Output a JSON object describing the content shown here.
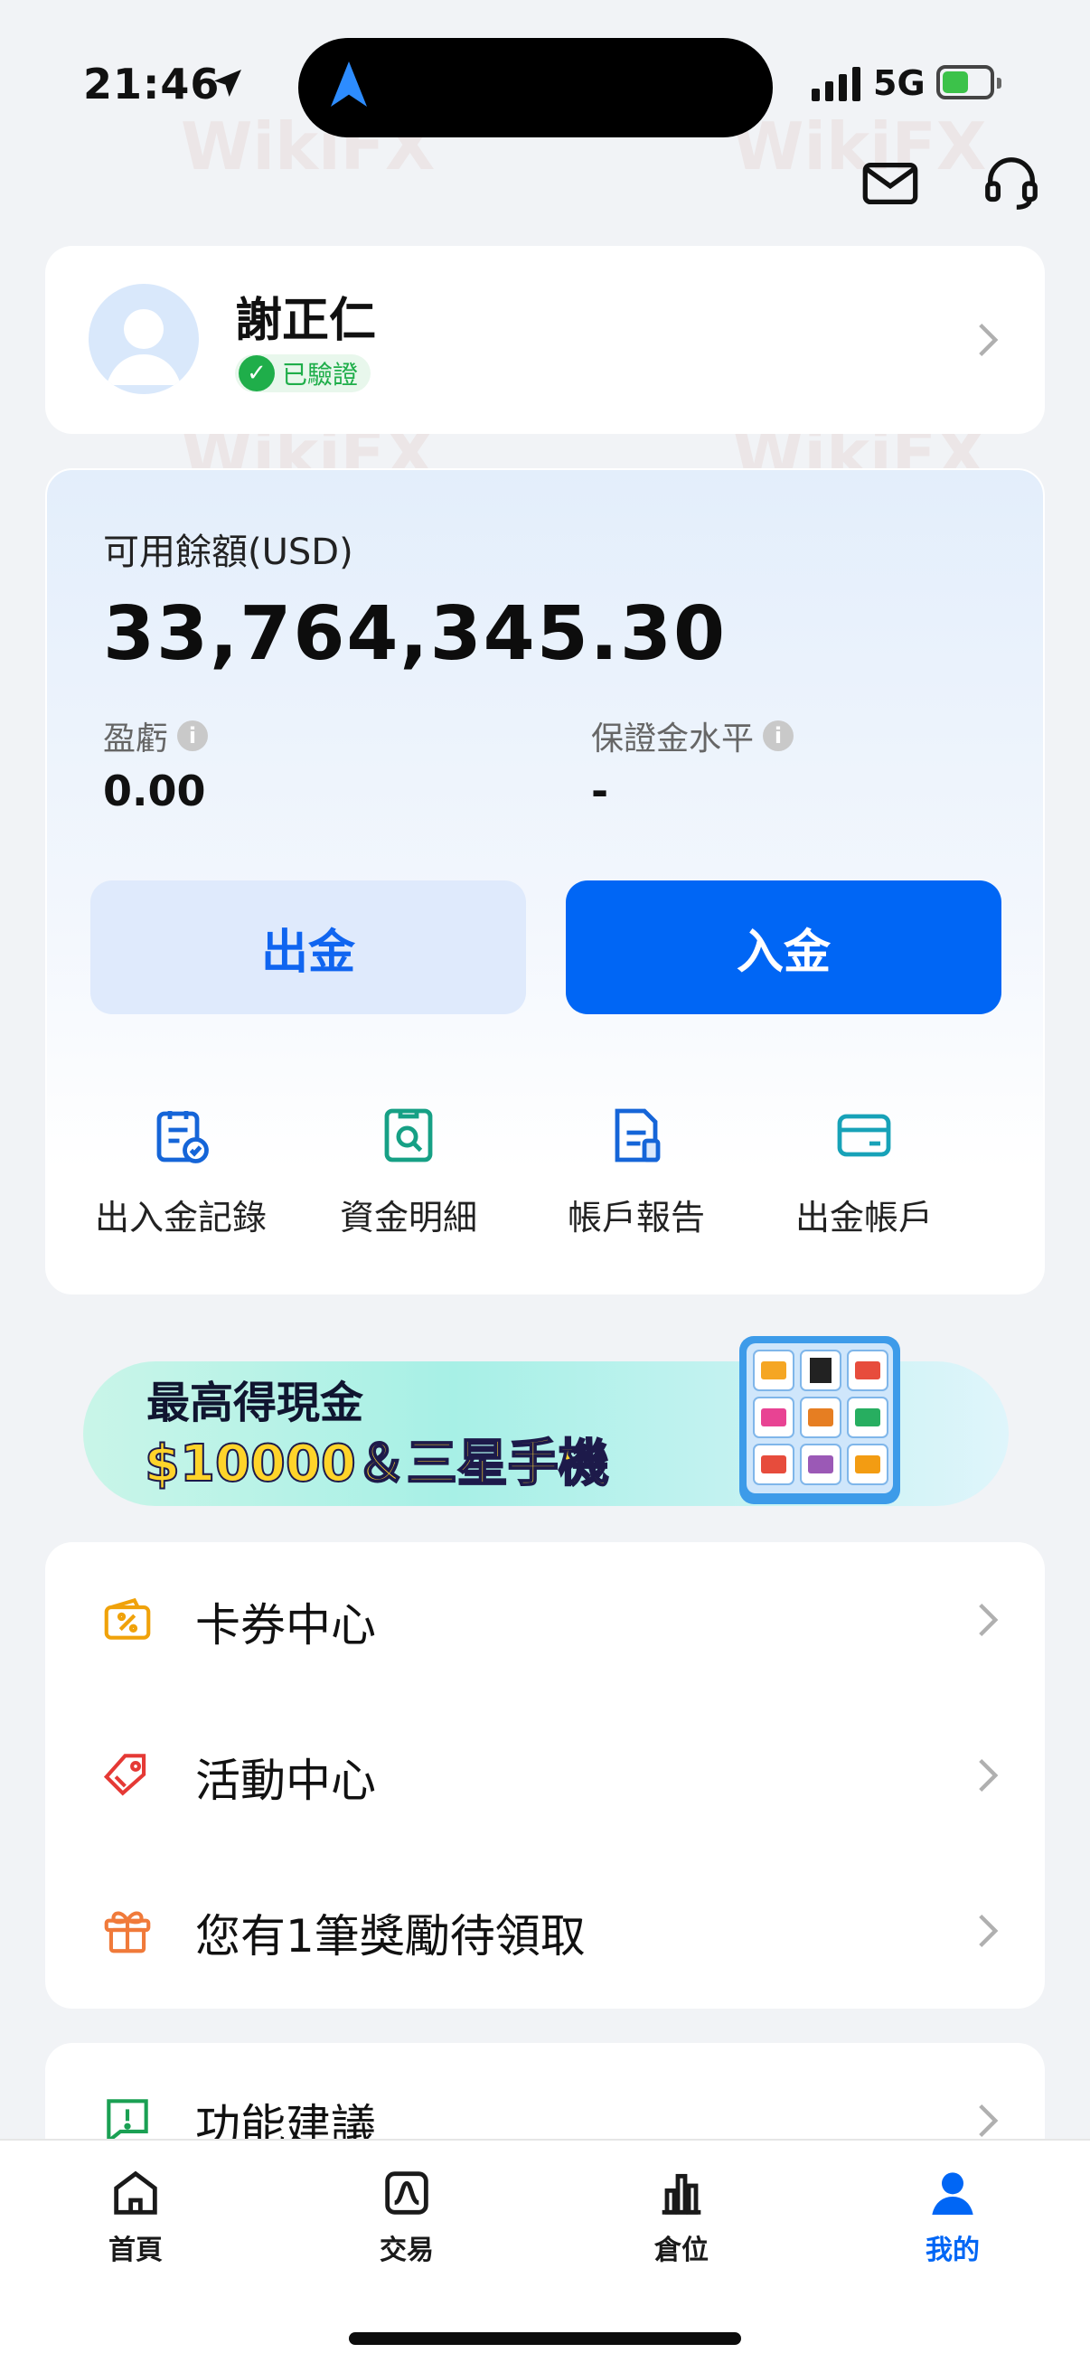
{
  "status_bar": {
    "time": "21:46",
    "network": "5G"
  },
  "header": {
    "mail_icon": "mail-icon",
    "support_icon": "headset-icon"
  },
  "profile": {
    "name": "謝正仁",
    "verified_label": "已驗證"
  },
  "balance": {
    "label": "可用餘額(USD)",
    "value": "33,764,345.30",
    "pnl_label": "盈虧",
    "pnl_value": "0.00",
    "margin_label": "保證金水平",
    "margin_value": "-",
    "withdraw_label": "出金",
    "deposit_label": "入金"
  },
  "quick_actions": [
    {
      "label": "出入金記錄",
      "icon": "clipboard-check-icon"
    },
    {
      "label": "資金明細",
      "icon": "search-document-icon"
    },
    {
      "label": "帳戶報告",
      "icon": "report-icon"
    },
    {
      "label": "出金帳戶",
      "icon": "card-icon"
    }
  ],
  "banner": {
    "line1": "最高得現金",
    "line2": "$10000＆三星手機"
  },
  "menu": [
    {
      "label": "卡券中心",
      "icon": "coupon-icon"
    },
    {
      "label": "活動中心",
      "icon": "tag-icon"
    },
    {
      "label": "您有1筆獎勵待領取",
      "icon": "gift-icon"
    },
    {
      "label": "功能建議",
      "icon": "feedback-icon"
    }
  ],
  "tabs": [
    {
      "label": "首頁",
      "icon": "home-icon"
    },
    {
      "label": "交易",
      "icon": "trade-icon"
    },
    {
      "label": "倉位",
      "icon": "position-icon"
    },
    {
      "label": "我的",
      "icon": "profile-icon",
      "active": true
    }
  ],
  "colors": {
    "primary": "#0066f5",
    "verified": "#1fae4a",
    "background": "#f1f3f6"
  }
}
